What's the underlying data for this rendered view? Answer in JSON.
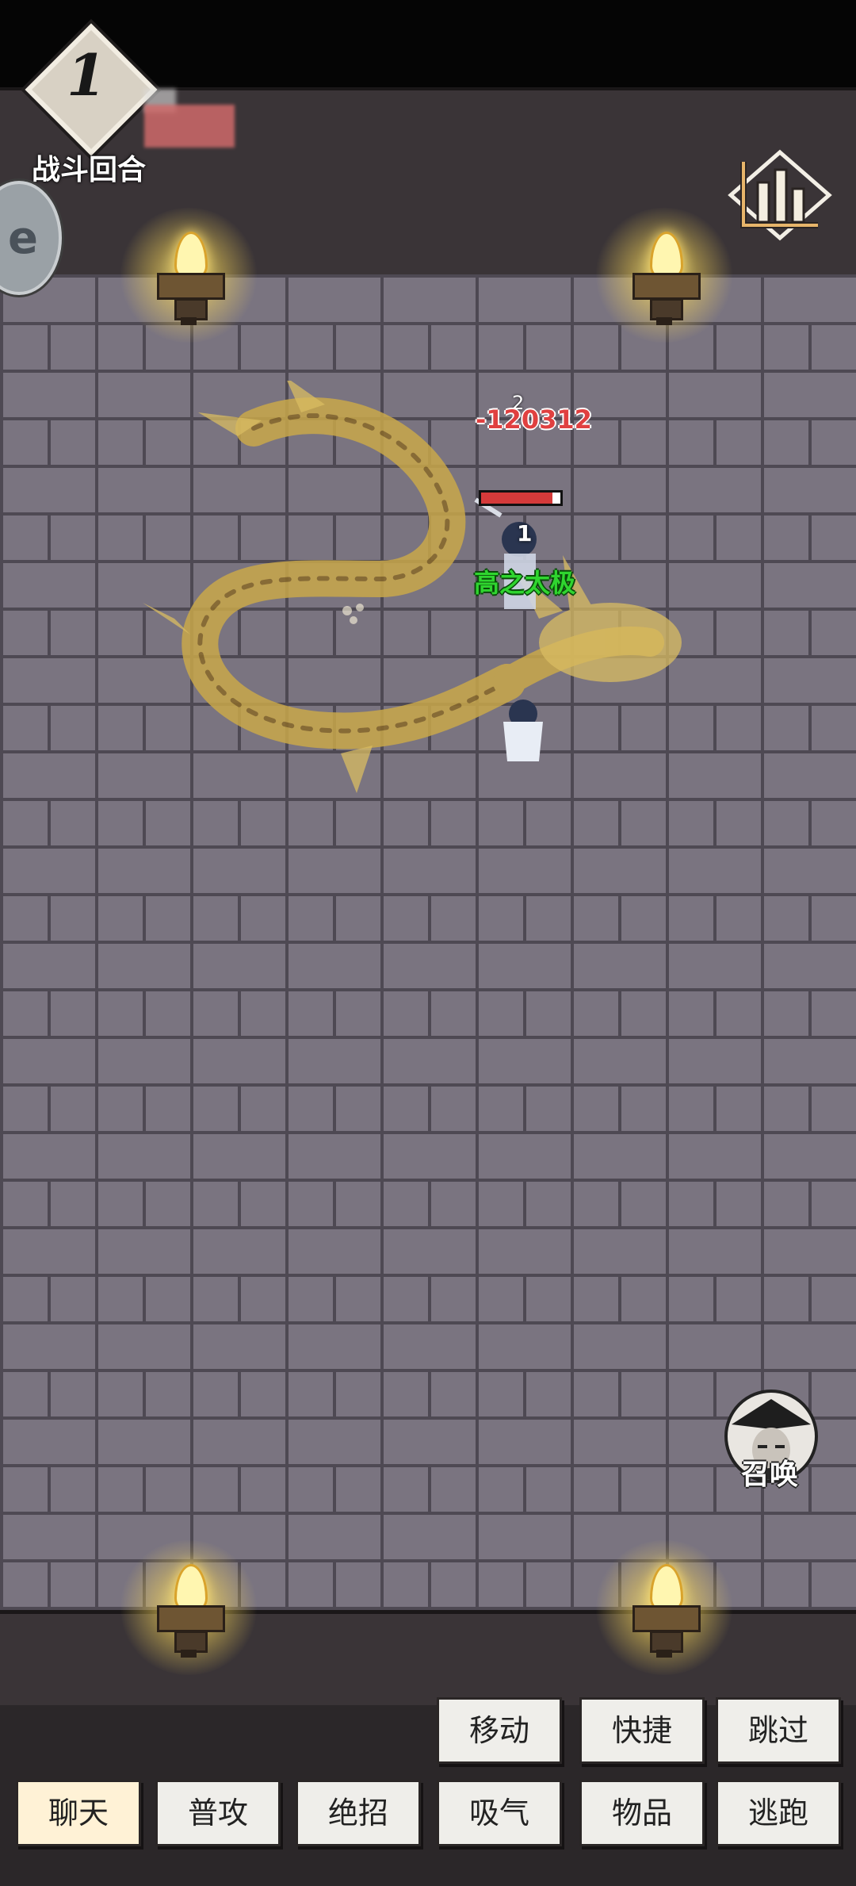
{
  "hud": {
    "round_number": "1",
    "round_label": "战斗回合"
  },
  "battle": {
    "damage_value": "-120312",
    "damage_count": "2",
    "hero_index": "1",
    "hero_hp_fraction": 0.9,
    "skill_name": "高之太极"
  },
  "summon": {
    "label": "召唤"
  },
  "actions": {
    "row1": [
      "移动",
      "快捷",
      "跳过"
    ],
    "row2": [
      "聊天",
      "普攻",
      "绝招",
      "吸气",
      "物品",
      "逃跑"
    ]
  },
  "colors": {
    "wall": "#7a7480",
    "mortar": "#4e4953",
    "ledge": "#3a3437",
    "damage": "#e04040",
    "skill": "#2fd52f",
    "dragon": "#c9a84a"
  }
}
